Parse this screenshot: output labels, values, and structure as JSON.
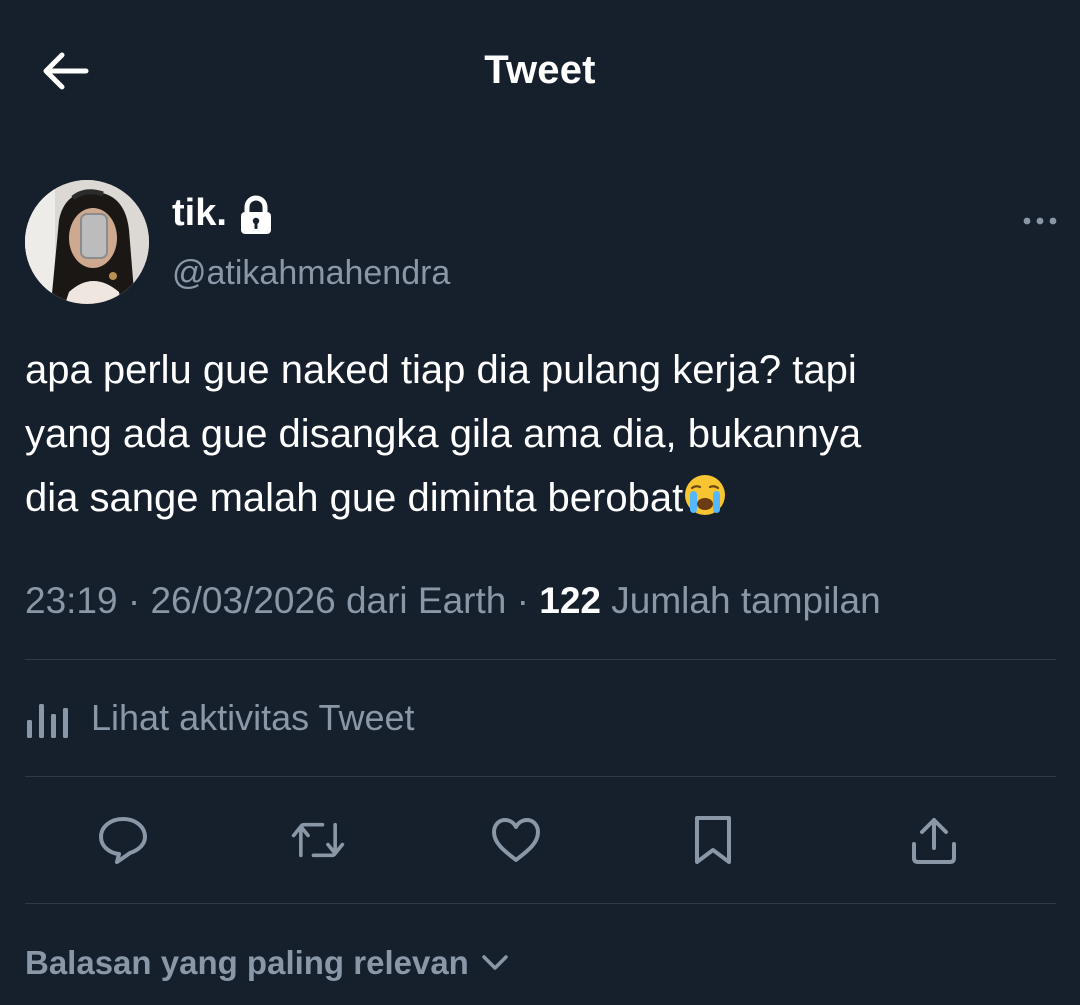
{
  "header": {
    "title": "Tweet",
    "back_icon": "arrow-left-icon"
  },
  "author": {
    "name": "tik.",
    "protected_icon": "lock-icon",
    "handle": "@atikahmahendra"
  },
  "tweet": {
    "lines": [
      "apa perlu gue naked tiap dia pulang kerja? tapi",
      "yang ada gue disangka gila ama dia, bukannya",
      "dia sange malah gue diminta berobat"
    ],
    "emoji": "crying-face-emoji"
  },
  "meta": {
    "time": "23:19",
    "sep1": "·",
    "date": "26/03/2026",
    "source": "dari Earth",
    "sep2": "·",
    "views_count": "122",
    "views_label": "Jumlah tampilan"
  },
  "activity": {
    "label": "Lihat aktivitas Tweet",
    "icon": "analytics-icon"
  },
  "actions": [
    {
      "icon": "reply-icon"
    },
    {
      "icon": "retweet-icon"
    },
    {
      "icon": "like-icon"
    },
    {
      "icon": "bookmark-icon"
    },
    {
      "icon": "share-icon"
    }
  ],
  "replies": {
    "sort_label": "Balasan yang paling relevan",
    "icon": "chevron-down-icon"
  },
  "colors": {
    "background": "#161f2c",
    "text": "#ffffff",
    "secondary": "#8a97a6",
    "divider": "#2e3a47"
  }
}
